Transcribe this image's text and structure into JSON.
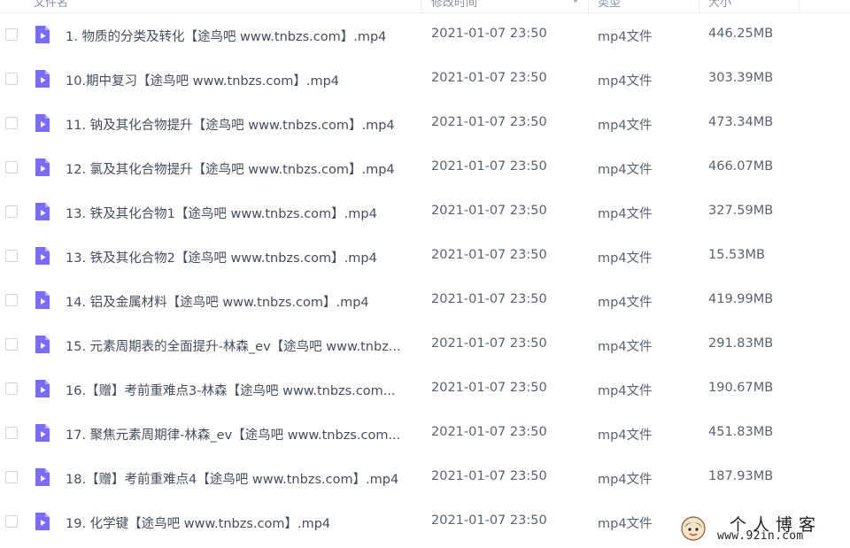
{
  "colors": {
    "accent": "#7b6cf6",
    "text": "#454d5a",
    "muted": "#5a626e"
  },
  "header": {
    "columns": [
      "文件名",
      "修改时间",
      "类型",
      "大小"
    ]
  },
  "files": [
    {
      "name": "1. 物质的分类及转化【途鸟吧 www.tnbzs.com】.mp4",
      "date": "2021-01-07 23:50",
      "type": "mp4文件",
      "size": "446.25MB",
      "icon": "video-file-icon"
    },
    {
      "name": "10.期中复习【途鸟吧 www.tnbzs.com】.mp4",
      "date": "2021-01-07 23:50",
      "type": "mp4文件",
      "size": "303.39MB",
      "icon": "video-file-icon"
    },
    {
      "name": "11. 钠及其化合物提升【途鸟吧 www.tnbzs.com】.mp4",
      "date": "2021-01-07 23:50",
      "type": "mp4文件",
      "size": "473.34MB",
      "icon": "video-file-icon"
    },
    {
      "name": "12. 氯及其化合物提升【途鸟吧 www.tnbzs.com】.mp4",
      "date": "2021-01-07 23:50",
      "type": "mp4文件",
      "size": "466.07MB",
      "icon": "video-file-icon"
    },
    {
      "name": "13. 铁及其化合物1【途鸟吧 www.tnbzs.com】.mp4",
      "date": "2021-01-07 23:50",
      "type": "mp4文件",
      "size": "327.59MB",
      "icon": "video-file-icon"
    },
    {
      "name": "13. 铁及其化合物2【途鸟吧 www.tnbzs.com】.mp4",
      "date": "2021-01-07 23:50",
      "type": "mp4文件",
      "size": "15.53MB",
      "icon": "video-file-icon"
    },
    {
      "name": "14. 铝及金属材料【途鸟吧 www.tnbzs.com】.mp4",
      "date": "2021-01-07 23:50",
      "type": "mp4文件",
      "size": "419.99MB",
      "icon": "video-file-icon"
    },
    {
      "name": "15. 元素周期表的全面提升-林森_ev【途鸟吧 www.tnbz...",
      "date": "2021-01-07 23:50",
      "type": "mp4文件",
      "size": "291.83MB",
      "icon": "video-file-icon"
    },
    {
      "name": "16.【赠】考前重难点3-林森【途鸟吧 www.tnbzs.com...",
      "date": "2021-01-07 23:50",
      "type": "mp4文件",
      "size": "190.67MB",
      "icon": "video-file-icon"
    },
    {
      "name": "17. 聚焦元素周期律-林森_ev【途鸟吧 www.tnbzs.com...",
      "date": "2021-01-07 23:50",
      "type": "mp4文件",
      "size": "451.83MB",
      "icon": "video-file-icon"
    },
    {
      "name": "18.【赠】考前重难点4【途鸟吧 www.tnbzs.com】.mp4",
      "date": "2021-01-07 23:50",
      "type": "mp4文件",
      "size": "187.93MB",
      "icon": "video-file-icon"
    },
    {
      "name": "19. 化学键【途鸟吧 www.tnbzs.com】.mp4",
      "date": "2021-01-07 23:50",
      "type": "mp4文件",
      "size": "",
      "icon": "video-file-icon"
    }
  ],
  "watermark": {
    "title": "个人博客",
    "url": "www.92in.com"
  }
}
